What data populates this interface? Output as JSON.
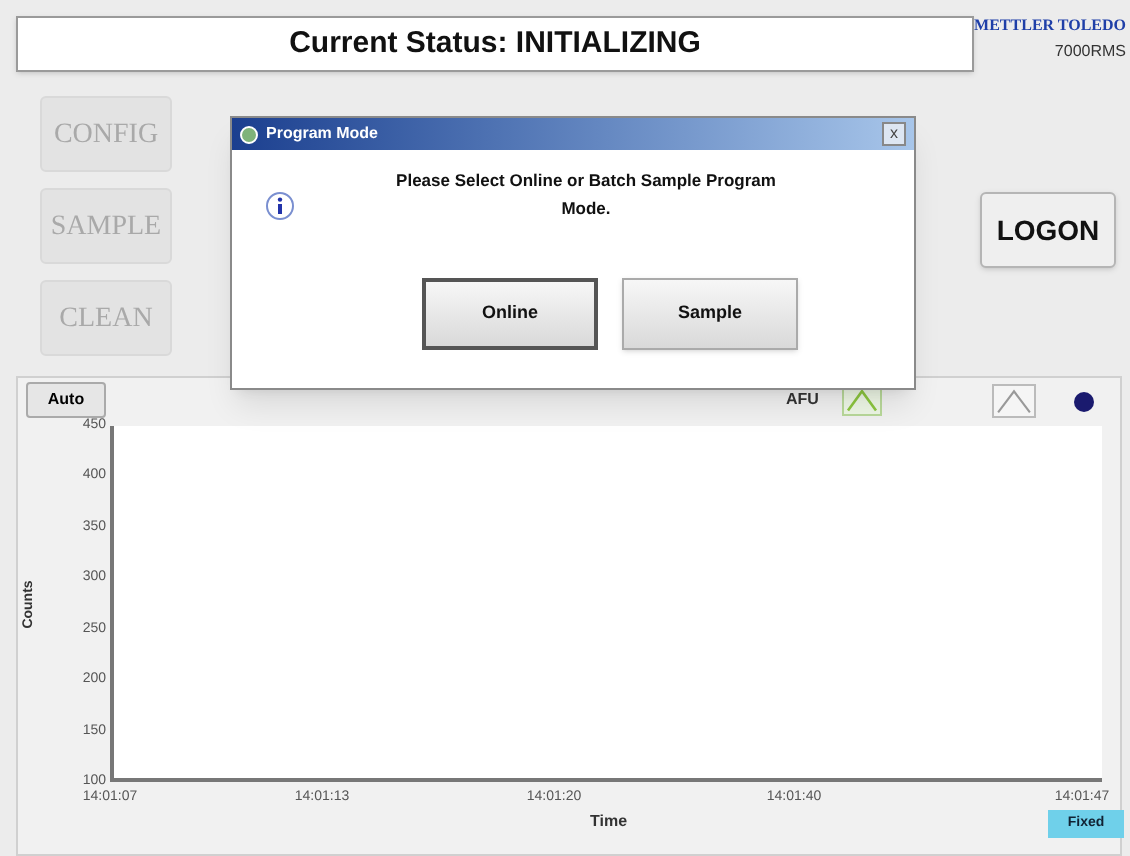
{
  "status_bar": {
    "text": "Current Status: INITIALIZING"
  },
  "brand": {
    "logo": "METTLER TOLEDO",
    "model": "7000RMS"
  },
  "side_buttons": [
    {
      "label": "CONFIG",
      "disabled": true
    },
    {
      "label": "SAMPLE",
      "disabled": true
    },
    {
      "label": "CLEAN",
      "disabled": true
    }
  ],
  "logon_button": {
    "label": "LOGON"
  },
  "dialog": {
    "title": "Program Mode",
    "close": "x",
    "message": "Please Select Online or Batch Sample Program Mode.",
    "buttons": [
      {
        "label": "Online",
        "selected": true
      },
      {
        "label": "Sample",
        "selected": false
      }
    ]
  },
  "chart_panel": {
    "scale_button": "Auto",
    "unit": "AFU",
    "ylabel": "Counts",
    "xlabel": "Time",
    "yticks": [
      "450",
      "400",
      "350",
      "300",
      "250",
      "200",
      "150",
      "100"
    ],
    "xticks": [
      "14:01:07",
      "14:01:13",
      "14:01:20",
      "14:01:40",
      "14:01:47"
    ],
    "mode_button": "Fixed"
  }
}
